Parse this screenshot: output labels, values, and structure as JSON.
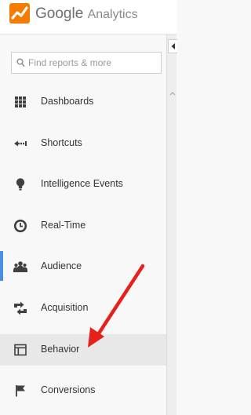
{
  "header": {
    "brand": "Google",
    "product": "Analytics"
  },
  "search": {
    "placeholder": "Find reports & more",
    "icon": "search-icon"
  },
  "nav": {
    "items": [
      {
        "label": "Dashboards",
        "icon": "dashboards-grid-icon"
      },
      {
        "label": "Shortcuts",
        "icon": "shortcuts-arrow-icon"
      },
      {
        "label": "Intelligence Events",
        "icon": "lightbulb-icon"
      },
      {
        "label": "Real-Time",
        "icon": "clock-icon"
      },
      {
        "label": "Audience",
        "icon": "people-icon"
      },
      {
        "label": "Acquisition",
        "icon": "acquisition-arrows-icon"
      },
      {
        "label": "Behavior",
        "icon": "behavior-layout-icon"
      },
      {
        "label": "Conversions",
        "icon": "flag-icon"
      }
    ]
  },
  "colors": {
    "brand_orange": "#f57c00",
    "annotation_arrow": "#e8201c",
    "active_indicator": "#4a90e2",
    "hover_background": "#e8e8e8",
    "icon_color": "#404040"
  }
}
